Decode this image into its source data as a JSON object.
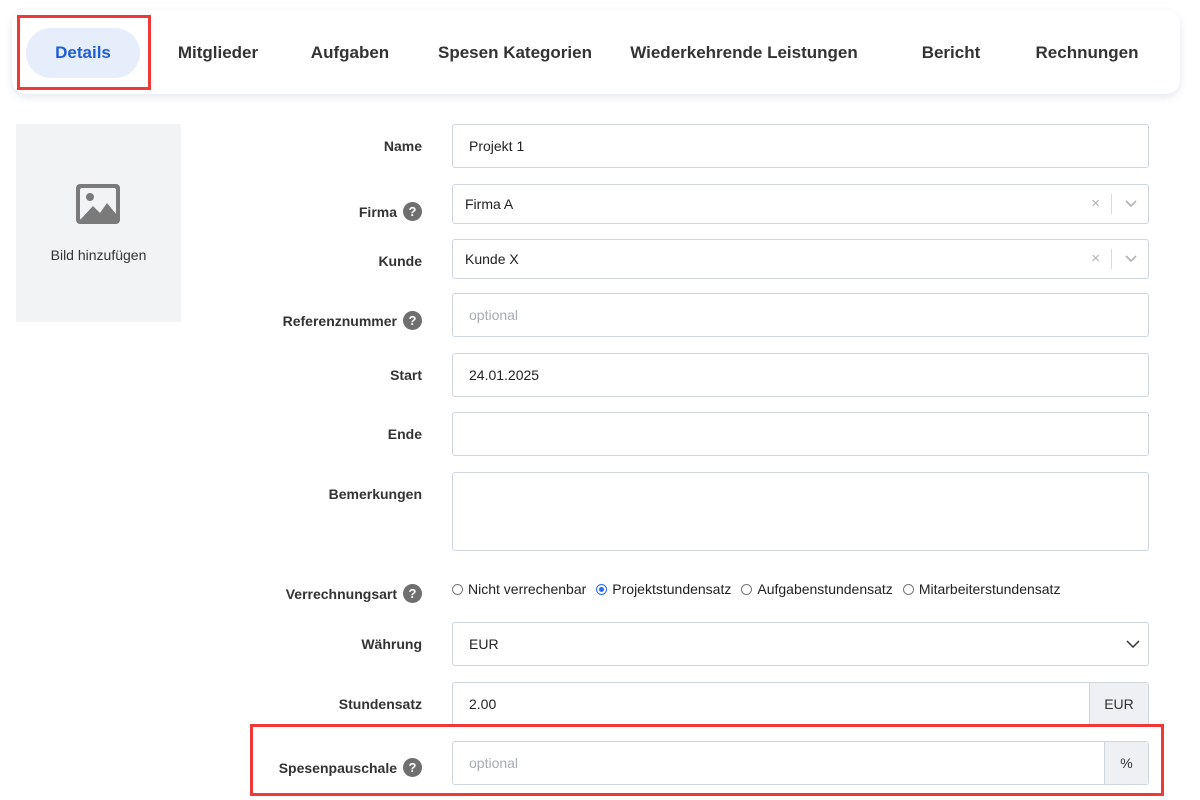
{
  "tabs": [
    {
      "label": "Details",
      "active": true
    },
    {
      "label": "Mitglieder"
    },
    {
      "label": "Aufgaben"
    },
    {
      "label": "Spesen Kategorien"
    },
    {
      "label": "Wiederkehrende Leistungen"
    },
    {
      "label": "Bericht"
    },
    {
      "label": "Rechnungen"
    }
  ],
  "image": {
    "label": "Bild hinzufügen",
    "icon": "image-placeholder-icon"
  },
  "form": {
    "name": {
      "label": "Name",
      "value": "Projekt 1"
    },
    "firma": {
      "label": "Firma",
      "value": "Firma A",
      "help": "?"
    },
    "kunde": {
      "label": "Kunde",
      "value": "Kunde X"
    },
    "referenz": {
      "label": "Referenznummer",
      "placeholder": "optional",
      "help": "?"
    },
    "start": {
      "label": "Start",
      "value": "24.01.2025"
    },
    "ende": {
      "label": "Ende",
      "value": ""
    },
    "bemerkungen": {
      "label": "Bemerkungen",
      "value": ""
    },
    "verrechnungsart": {
      "label": "Verrechnungsart",
      "help": "?",
      "options": [
        {
          "label": "Nicht verrechenbar",
          "selected": false
        },
        {
          "label": "Projektstundensatz",
          "selected": true
        },
        {
          "label": "Aufgabenstundensatz",
          "selected": false
        },
        {
          "label": "Mitarbeiterstundensatz",
          "selected": false
        }
      ]
    },
    "waehrung": {
      "label": "Währung",
      "value": "EUR"
    },
    "stundensatz": {
      "label": "Stundensatz",
      "value": "2.00",
      "unit": "EUR"
    },
    "spesenpauschale": {
      "label": "Spesenpauschale",
      "placeholder": "optional",
      "unit": "%",
      "help": "?"
    }
  },
  "select_clear_glyph": "×",
  "colors": {
    "accent": "#1f5fd6",
    "active_tab_bg": "#e6eefb",
    "annotation": "#ef3838"
  }
}
